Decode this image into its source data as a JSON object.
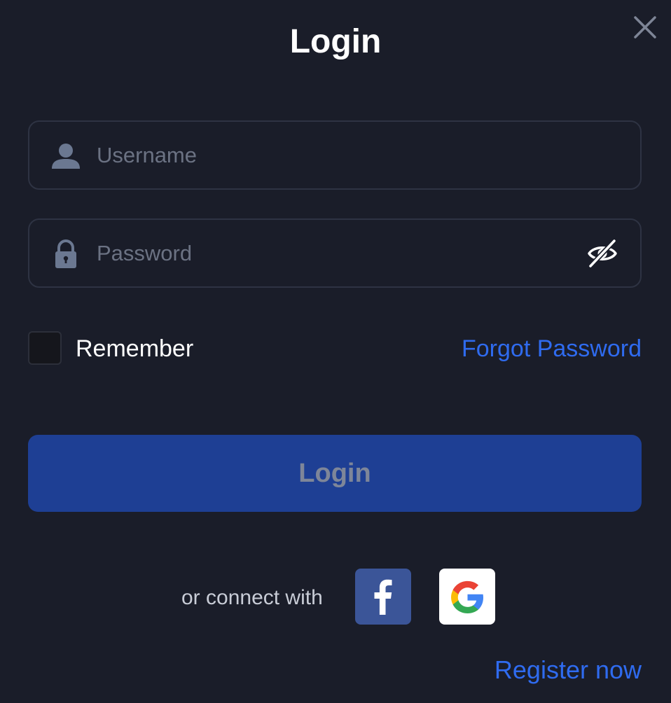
{
  "modal": {
    "title": "Login",
    "close_icon": "close-icon"
  },
  "username": {
    "icon": "user-icon",
    "placeholder": "Username",
    "value": ""
  },
  "password": {
    "icon": "lock-icon",
    "placeholder": "Password",
    "value": "",
    "toggle_icon": "eye-off-icon"
  },
  "remember": {
    "label": "Remember",
    "checked": false
  },
  "forgot_password": {
    "label": "Forgot Password"
  },
  "login_button": {
    "label": "Login"
  },
  "social": {
    "label": "or connect with",
    "providers": [
      "facebook",
      "google"
    ]
  },
  "register": {
    "label": "Register now"
  },
  "colors": {
    "background": "#1a1d29",
    "field_border": "#2e3343",
    "accent_link": "#2f6bef",
    "login_button_bg": "#1e3f94",
    "login_button_text": "#7e8699",
    "facebook_bg": "#3b5598"
  }
}
